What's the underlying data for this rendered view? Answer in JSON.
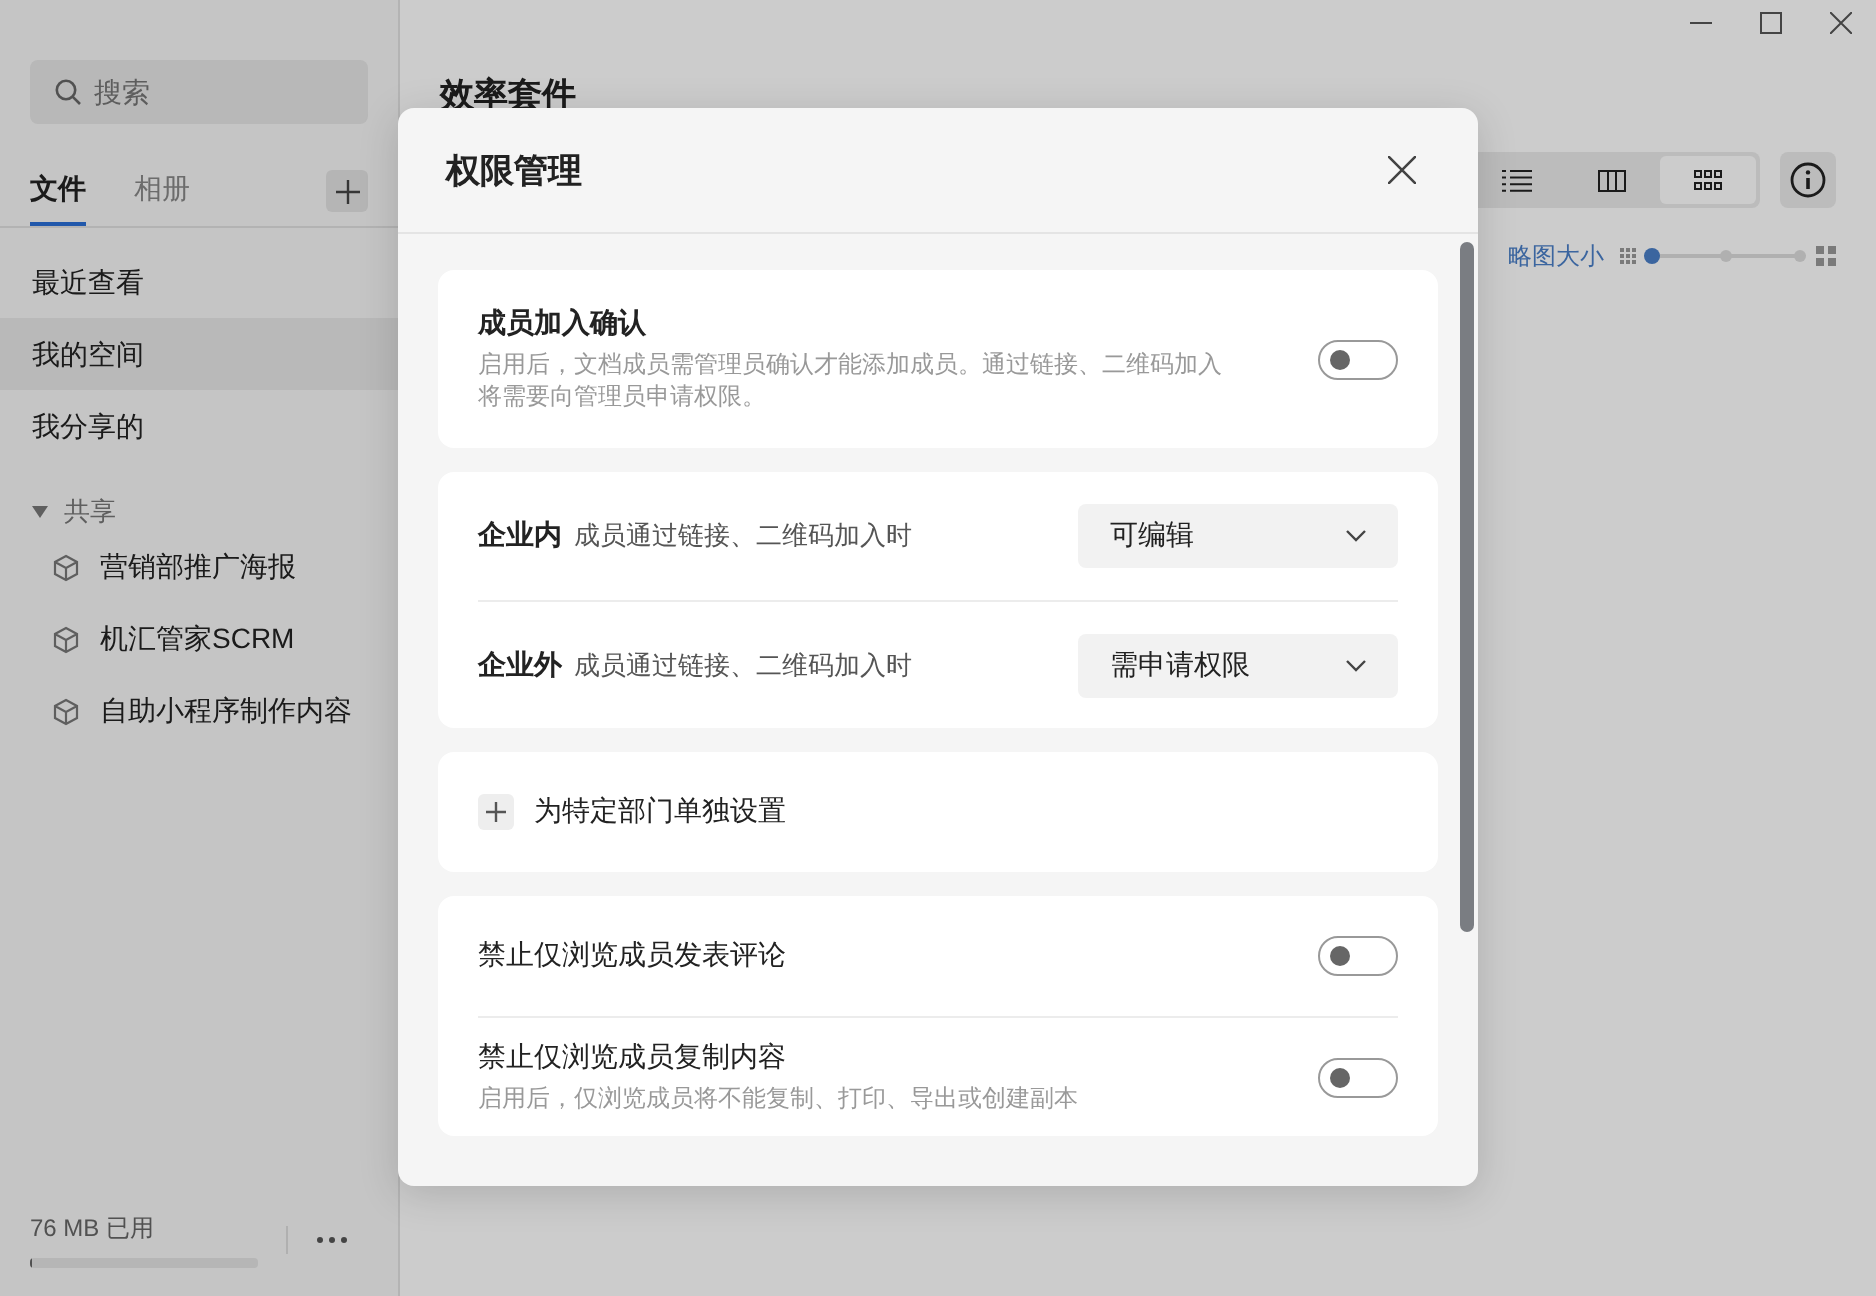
{
  "sidebar": {
    "search": {
      "placeholder": "搜索"
    },
    "tabs": [
      {
        "label": "文件",
        "selected": true
      },
      {
        "label": "相册",
        "selected": false
      }
    ],
    "nav": [
      {
        "label": "最近查看",
        "selected": false
      },
      {
        "label": "我的空间",
        "selected": true
      },
      {
        "label": "我分享的",
        "selected": false
      }
    ],
    "shared": {
      "label": "共享",
      "expanded": true,
      "items": [
        {
          "label": "营销部推广海报"
        },
        {
          "label": "机汇管家SCRM"
        },
        {
          "label": "自助小程序制作内容"
        }
      ]
    },
    "storage": {
      "text": "76 MB 已用",
      "level": 0.01
    }
  },
  "main": {
    "title": "效率套件",
    "views": [
      {
        "kind": "list",
        "selected": false
      },
      {
        "kind": "columns",
        "selected": false
      },
      {
        "kind": "grid",
        "selected": true
      }
    ],
    "thumbnail_size": {
      "label": "略图大小",
      "level": 0
    }
  },
  "dialog": {
    "title": "权限管理",
    "sections": [
      {
        "rows": [
          {
            "kind": "toggle",
            "title": "成员加入确认",
            "emphasis": true,
            "description": "启用后，文档成员需管理员确认才能添加成员。通过链接、二维码加入将需要向管理员申请权限。",
            "on": false
          }
        ]
      },
      {
        "rows": [
          {
            "kind": "select",
            "label": "企业内",
            "description": "成员通过链接、二维码加入时",
            "value": "可编辑"
          },
          {
            "kind": "select",
            "label": "企业外",
            "description": "成员通过链接、二维码加入时",
            "value": "需申请权限"
          }
        ]
      },
      {
        "rows": [
          {
            "kind": "action",
            "label": "为特定部门单独设置"
          }
        ]
      },
      {
        "rows": [
          {
            "kind": "toggle",
            "title": "禁止仅浏览成员发表评论",
            "emphasis": false,
            "on": false
          },
          {
            "kind": "toggle",
            "title": "禁止仅浏览成员复制内容",
            "emphasis": false,
            "description": "启用后，仅浏览成员将不能复制、打印、导出或创建副本",
            "on": false
          }
        ]
      }
    ]
  }
}
